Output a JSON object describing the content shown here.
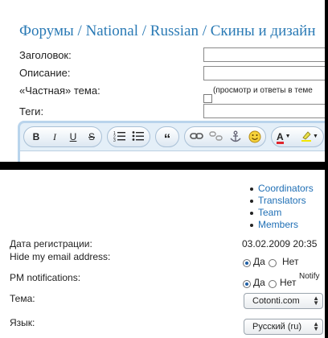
{
  "top": {
    "breadcrumb": "Форумы / National / Russian / Скины и дизайн",
    "fields": {
      "title_label": "Заголовок:",
      "description_label": "Описание:",
      "private_label": "«Частная» тема:",
      "private_hint": "(просмотр и ответы в теме",
      "tags_label": "Теги:"
    },
    "toolbar": {
      "bold": "B",
      "italic": "I",
      "underline": "U",
      "strike": "S",
      "quote": "“",
      "font_color": "A"
    }
  },
  "bottom": {
    "nav_links": [
      "Coordinators",
      "Translators",
      "Team",
      "Members"
    ],
    "reg_date_label": "Дата регистрации:",
    "reg_date_value": "03.02.2009 20:35",
    "hide_email_label": "Hide my email address:",
    "pm_label": "PM notifications:",
    "yes": "Да",
    "no": "Нет",
    "notify": "Notify",
    "theme_label": "Тема:",
    "theme_value": "Cotonti.com",
    "lang_label": "Язык:",
    "lang_value": "Русский (ru)"
  }
}
